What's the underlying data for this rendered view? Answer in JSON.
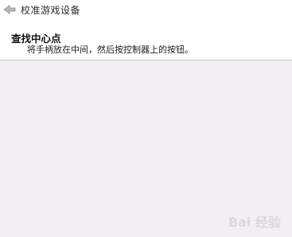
{
  "window": {
    "title": "校准游戏设备",
    "back_icon": "back-arrow-icon"
  },
  "header": {
    "heading": "查找中心点",
    "instruction": "将手柄放在中间，然后按控制器上的按钮。"
  },
  "watermark": {
    "text": "Bai 经验"
  }
}
